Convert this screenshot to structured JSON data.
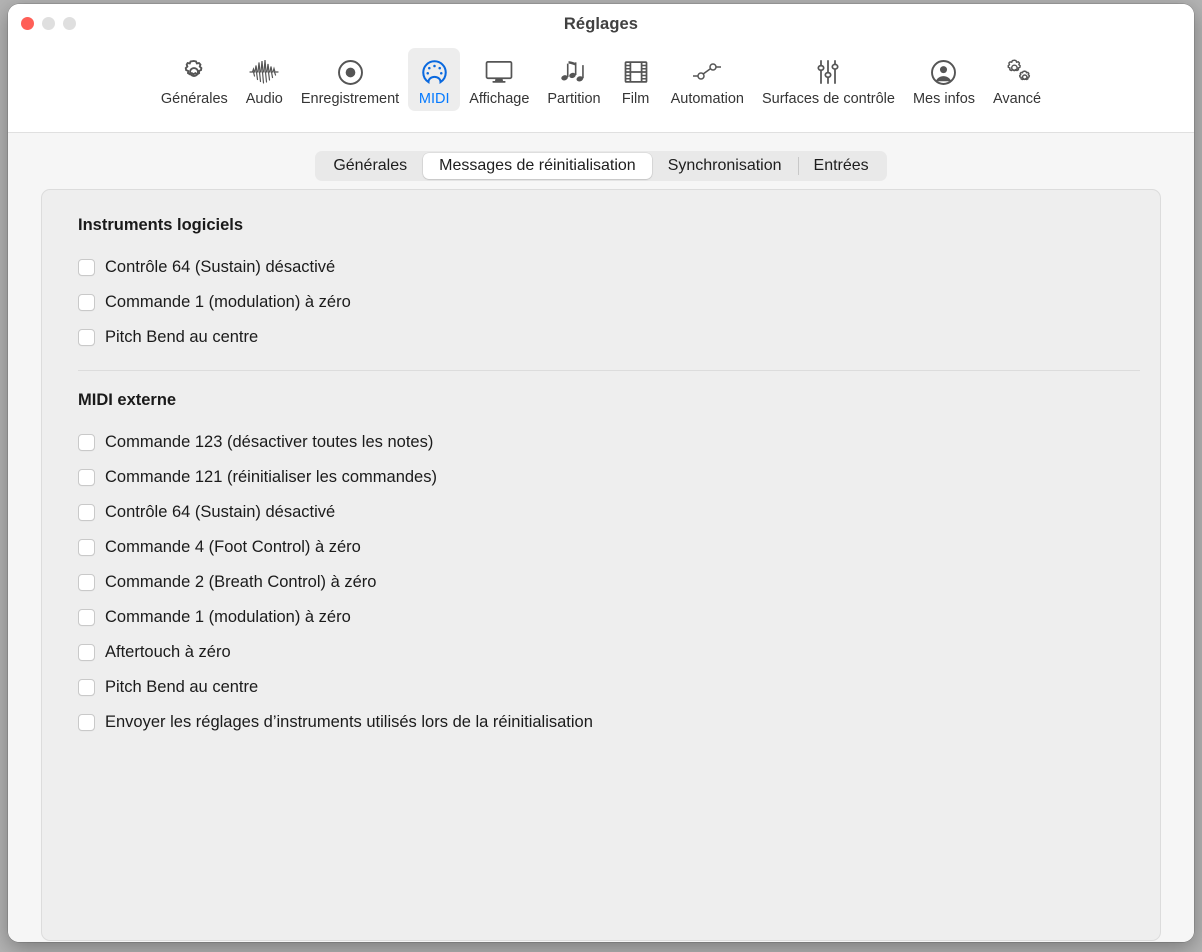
{
  "window": {
    "title": "Réglages",
    "traffic_lights": [
      "close-button",
      "minimize-button",
      "zoom-button"
    ]
  },
  "toolbar": {
    "items": [
      {
        "label": "Générales",
        "icon": "gear-icon",
        "selected": false
      },
      {
        "label": "Audio",
        "icon": "waveform-icon",
        "selected": false
      },
      {
        "label": "Enregistrement",
        "icon": "record-circle-icon",
        "selected": false
      },
      {
        "label": "MIDI",
        "icon": "midi-din-connector-icon",
        "selected": true
      },
      {
        "label": "Affichage",
        "icon": "display-monitor-icon",
        "selected": false
      },
      {
        "label": "Partition",
        "icon": "music-notes-icon",
        "selected": false
      },
      {
        "label": "Film",
        "icon": "film-strip-icon",
        "selected": false
      },
      {
        "label": "Automation",
        "icon": "automation-nodes-icon",
        "selected": false
      },
      {
        "label": "Surfaces de contrôle",
        "icon": "sliders-icon",
        "selected": false
      },
      {
        "label": "Mes infos",
        "icon": "person-circle-icon",
        "selected": false
      },
      {
        "label": "Avancé",
        "icon": "double-gears-icon",
        "selected": false
      }
    ]
  },
  "tabs": {
    "items": [
      {
        "label": "Générales",
        "selected": false,
        "divided": false
      },
      {
        "label": "Messages de réinitialisation",
        "selected": true,
        "divided": false
      },
      {
        "label": "Synchronisation",
        "selected": false,
        "divided": false
      },
      {
        "label": "Entrées",
        "selected": false,
        "divided": true
      }
    ]
  },
  "sections": [
    {
      "title": "Instruments logiciels",
      "options": [
        {
          "label": "Contrôle 64 (Sustain) désactivé",
          "checked": false
        },
        {
          "label": "Commande 1 (modulation) à zéro",
          "checked": false
        },
        {
          "label": "Pitch Bend au centre",
          "checked": false
        }
      ]
    },
    {
      "title": "MIDI externe",
      "options": [
        {
          "label": "Commande 123 (désactiver toutes les notes)",
          "checked": false
        },
        {
          "label": "Commande 121 (réinitialiser les commandes)",
          "checked": false
        },
        {
          "label": "Contrôle 64 (Sustain) désactivé",
          "checked": false
        },
        {
          "label": "Commande 4 (Foot Control) à zéro",
          "checked": false
        },
        {
          "label": "Commande 2 (Breath Control) à zéro",
          "checked": false
        },
        {
          "label": "Commande 1 (modulation) à zéro",
          "checked": false
        },
        {
          "label": "Aftertouch à zéro",
          "checked": false
        },
        {
          "label": "Pitch Bend au centre",
          "checked": false
        },
        {
          "label": "Envoyer les réglages d’instruments utilisés lors de la réinitialisation",
          "checked": false
        }
      ]
    }
  ],
  "colors": {
    "accent": "#057aff",
    "close_light": "#ff5f57",
    "panel_bg": "#eeeeee",
    "body_bg": "#f6f6f6"
  }
}
